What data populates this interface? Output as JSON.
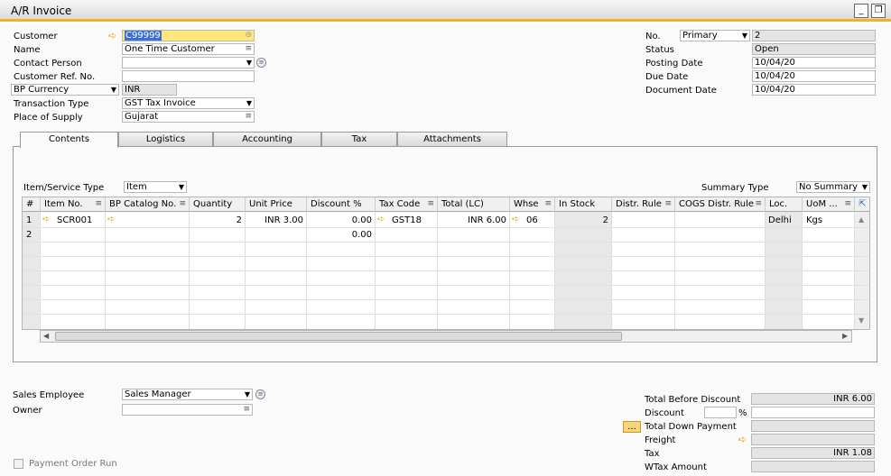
{
  "window": {
    "title": "A/R Invoice"
  },
  "header": {
    "customer": {
      "label": "Customer",
      "value": "C99999"
    },
    "name": {
      "label": "Name",
      "value": "One Time Customer"
    },
    "contact_person": {
      "label": "Contact Person",
      "value": ""
    },
    "customer_ref": {
      "label": "Customer Ref. No.",
      "value": ""
    },
    "bp_currency": {
      "label": "BP Currency",
      "value": "INR"
    },
    "transaction_type": {
      "label": "Transaction Type",
      "value": "GST Tax Invoice"
    },
    "place_of_supply": {
      "label": "Place of Supply",
      "value": "Gujarat"
    },
    "no": {
      "label": "No.",
      "series": "Primary",
      "value": "2"
    },
    "status": {
      "label": "Status",
      "value": "Open"
    },
    "posting_date": {
      "label": "Posting Date",
      "value": "10/04/20"
    },
    "due_date": {
      "label": "Due Date",
      "value": "10/04/20"
    },
    "document_date": {
      "label": "Document Date",
      "value": "10/04/20"
    }
  },
  "tabs": [
    "Contents",
    "Logistics",
    "Accounting",
    "Tax",
    "Attachments"
  ],
  "contents": {
    "item_service_type": {
      "label": "Item/Service Type",
      "value": "Item"
    },
    "summary_type": {
      "label": "Summary Type",
      "value": "No Summary"
    },
    "columns": [
      "#",
      "Item No.",
      "BP Catalog No.",
      "Quantity",
      "Unit Price",
      "Discount %",
      "Tax Code",
      "Total (LC)",
      "Whse",
      "In Stock",
      "Distr. Rule",
      "COGS Distr. Rule",
      "Loc.",
      "UoM ..."
    ],
    "rows": [
      {
        "num": "1",
        "item_no": "SCR001",
        "quantity": "2",
        "unit_price": "INR 3.00",
        "discount": "0.00",
        "tax_code": "GST18",
        "total": "INR 6.00",
        "whse": "06",
        "in_stock": "2",
        "loc": "Delhi",
        "uom": "Kgs"
      },
      {
        "num": "2",
        "discount": "0.00"
      }
    ]
  },
  "footer": {
    "sales_employee": {
      "label": "Sales Employee",
      "value": "Sales Manager"
    },
    "owner": {
      "label": "Owner",
      "value": ""
    },
    "payment_order_run": {
      "label": "Payment Order Run"
    },
    "total_before_discount": {
      "label": "Total Before Discount",
      "value": "INR 6.00"
    },
    "discount": {
      "label": "Discount",
      "percent_sign": "%",
      "value": ""
    },
    "total_down_payment": {
      "label": "Total Down Payment",
      "button": "...",
      "value": ""
    },
    "freight": {
      "label": "Freight",
      "value": ""
    },
    "tax": {
      "label": "Tax",
      "value": "INR 1.08"
    },
    "wtax_amount": {
      "label": "WTax Amount",
      "value": ""
    }
  },
  "colors": {
    "accent": "#f0b323",
    "highlight": "#ffe77a",
    "selection": "#3b6fd0"
  }
}
